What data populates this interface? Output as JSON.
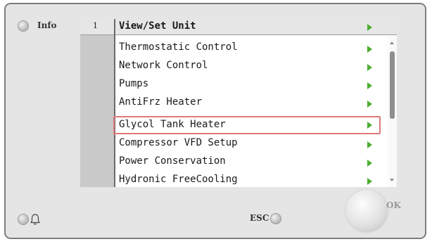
{
  "info": {
    "label": "Info"
  },
  "menu": {
    "level": "1",
    "title": "View/Set Unit",
    "items": [
      {
        "label": "Thermostatic Control"
      },
      {
        "label": "Network Control"
      },
      {
        "label": "Pumps"
      },
      {
        "label": "AntiFrz Heater"
      },
      {
        "label": "Glycol Tank Heater"
      },
      {
        "label": "Compressor VFD Setup"
      },
      {
        "label": "Power Conservation"
      },
      {
        "label": "Hydronic FreeCooling"
      }
    ],
    "selected_item": "Glycol Tank Heater",
    "arrow_color": "#4caf2e",
    "highlight_color": "#e07a7a"
  },
  "buttons": {
    "esc_label": "ESC",
    "ok_label": "OK"
  },
  "icons": {
    "alarm": "bell-icon",
    "submenu": "arrow-right-icon",
    "scroll_up": "scroll-up-icon",
    "scroll_down": "scroll-down-icon"
  }
}
